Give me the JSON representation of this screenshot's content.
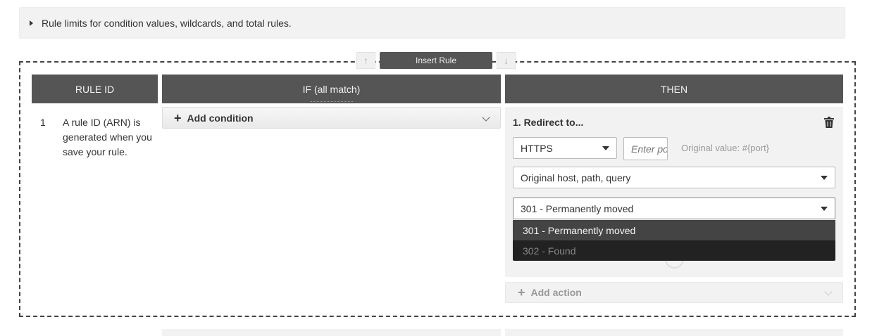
{
  "limits": {
    "label": "Rule limits for condition values, wildcards, and total rules."
  },
  "insert_bar": {
    "insert_label": "Insert Rule",
    "up_glyph": "↑",
    "down_glyph": "↓"
  },
  "columns": {
    "rule_id": "RULE ID",
    "if": "IF (all match)",
    "then": "THEN"
  },
  "rule": {
    "number": "1",
    "id_text": "A rule ID (ARN) is generated when you save your rule."
  },
  "conditions": {
    "add_label": "Add condition",
    "plus": "+"
  },
  "action": {
    "title": "1. Redirect to...",
    "protocol": "HTTPS",
    "port_placeholder": "Enter port",
    "original_value": "Original value: #{port}",
    "destination": "Original host, path, query",
    "status_code": "301 - Permanently moved",
    "status_options": [
      "301 - Permanently moved",
      "302 - Found"
    ]
  },
  "add_action": {
    "label": "Add action",
    "plus": "+"
  },
  "icons": [
    "caret-right-icon",
    "arrow-up-icon",
    "arrow-down-icon",
    "plus-icon",
    "chevron-down-icon",
    "trash-icon",
    "dropdown-triangle-icon",
    "check-circle-icon"
  ]
}
